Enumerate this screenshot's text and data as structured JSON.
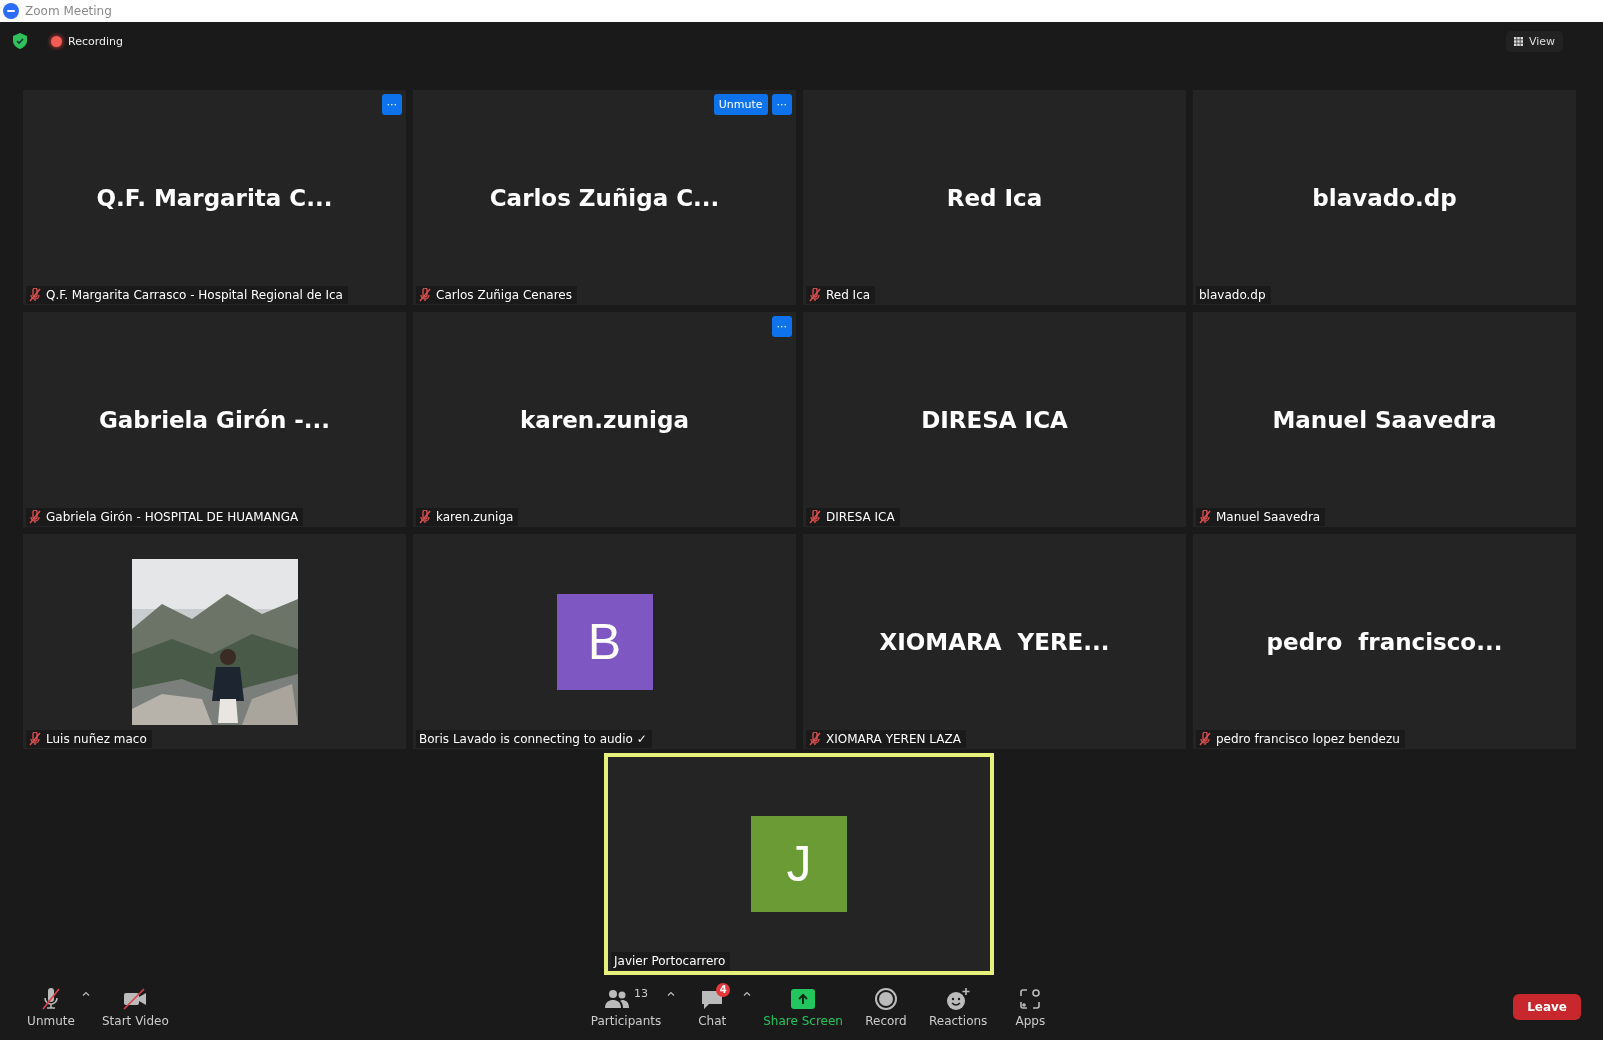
{
  "window": {
    "title": "Zoom Meeting"
  },
  "top_bar": {
    "recording": "Recording",
    "view_button": "View"
  },
  "tiles": [
    {
      "kind": "name",
      "display_name": "Q.F. Margarita C...",
      "label": "Q.F. Margarita Carrasco - Hospital Regional de Ica",
      "muted": true,
      "buttons": [
        "···"
      ]
    },
    {
      "kind": "name",
      "display_name": "Carlos Zuñiga C...",
      "label": "Carlos Zuñiga Cenares",
      "muted": true,
      "buttons": [
        "Unmute",
        "···"
      ]
    },
    {
      "kind": "name",
      "display_name": "Red Ica",
      "label": "Red Ica",
      "muted": true
    },
    {
      "kind": "name",
      "display_name": "blavado.dp",
      "label": "blavado.dp",
      "muted": false
    },
    {
      "kind": "name",
      "display_name": "Gabriela Girón -...",
      "label": "Gabriela Girón - HOSPITAL DE HUAMANGA",
      "muted": true
    },
    {
      "kind": "name",
      "display_name": "karen.zuniga",
      "label": "karen.zuniga",
      "muted": true,
      "buttons": [
        "···"
      ]
    },
    {
      "kind": "name",
      "display_name": "DIRESA ICA",
      "label": "DIRESA ICA",
      "muted": true
    },
    {
      "kind": "name",
      "display_name": "Manuel Saavedra",
      "label": "Manuel Saavedra",
      "muted": true
    },
    {
      "kind": "picture",
      "label": "Luis nuñez maco",
      "muted": true
    },
    {
      "kind": "avatar",
      "initial": "B",
      "color": "#7e57c2",
      "label": "Boris Lavado is connecting to audio ✓",
      "muted": false
    },
    {
      "kind": "name",
      "display_name": "XIOMARA  YERE...",
      "label": "XIOMARA YEREN LAZA",
      "muted": true
    },
    {
      "kind": "name",
      "display_name": "pedro  francisco...",
      "label": "pedro francisco lopez bendezu",
      "muted": true
    }
  ],
  "active_speaker": {
    "kind": "avatar",
    "initial": "J",
    "color": "#6a9b34",
    "label": "Javier Portocarrero",
    "muted": false,
    "highlighted": true
  },
  "toolbar": {
    "left": [
      {
        "kind": "mic",
        "label": "Unmute",
        "caret": true
      },
      {
        "kind": "video",
        "label": "Start Video",
        "caret": false
      }
    ],
    "center": [
      {
        "kind": "participants",
        "label": "Participants",
        "count": "13",
        "caret": true
      },
      {
        "kind": "chat",
        "label": "Chat",
        "badge": "4",
        "caret": true
      },
      {
        "kind": "share",
        "label": "Share Screen",
        "caret": false
      },
      {
        "kind": "record",
        "label": "Record",
        "caret": false
      },
      {
        "kind": "reactions",
        "label": "Reactions",
        "caret": false
      },
      {
        "kind": "apps",
        "label": "Apps",
        "caret": false
      }
    ],
    "leave_button": "Leave"
  }
}
